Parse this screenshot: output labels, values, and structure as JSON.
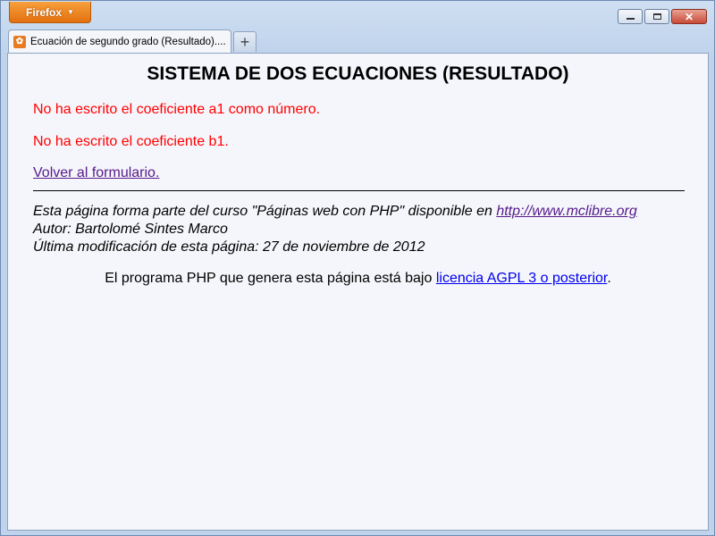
{
  "window": {
    "firefox_button": "Firefox",
    "controls": {
      "minimize": "minimize",
      "maximize": "maximize",
      "close": "close"
    }
  },
  "tab": {
    "title": "Ecuación de segundo grado (Resultado)....",
    "new_tab": "+"
  },
  "page": {
    "heading": "SISTEMA DE DOS ECUACIONES (RESULTADO)",
    "errors": [
      "No ha escrito el coeficiente a1 como número.",
      "No ha escrito el coeficiente b1."
    ],
    "back_link": "Volver al formulario.",
    "footer": {
      "line1_text": "Esta página forma parte del curso \"Páginas web con PHP\" disponible en ",
      "line1_link": "http://www.mclibre.org",
      "line2": "Autor: Bartolomé Sintes Marco",
      "line3": "Última modificación de esta página: 27 de noviembre de 2012"
    },
    "license": {
      "text_before": "El programa PHP que genera esta página está bajo ",
      "link": "licencia AGPL 3 o posterior",
      "text_after": "."
    }
  },
  "colors": {
    "error": "#ff0000",
    "visited_link": "#551a8b",
    "link": "#0000ee",
    "firefox_button": "#e3700f"
  }
}
